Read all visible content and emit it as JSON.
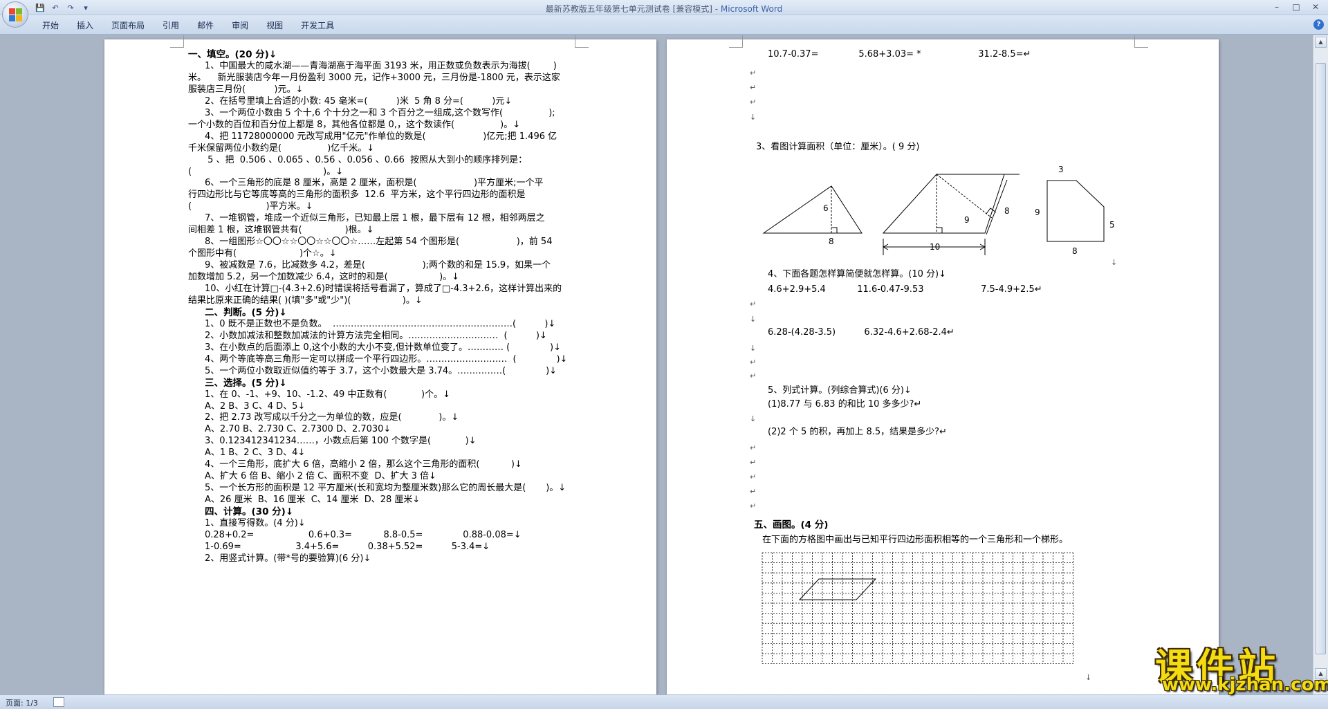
{
  "titlebar": {
    "doc_title": "最新苏教版五年级第七单元测试卷 [兼容模式] - ",
    "app_name": "Microsoft Word",
    "qat_save": "💾",
    "qat_undo": "↶",
    "qat_redo": "↷",
    "qat_more": "▾",
    "min": "–",
    "max": "□",
    "close": "✕"
  },
  "ribbon": {
    "tabs": [
      "开始",
      "插入",
      "页面布局",
      "引用",
      "邮件",
      "审阅",
      "视图",
      "开发工具"
    ],
    "help": "?"
  },
  "page1": {
    "lines": [
      "一、填空。(20 分)↓",
      "1、中国最大的咸水湖——青海湖高于海平面 3193 米，用正数或负数表示为海拔(        )",
      "米。    新光服装店今年一月份盈利 3000 元，记作+3000 元，三月份是-1800 元，表示这家",
      "服装店三月份(          )元。↓",
      "2、在括号里填上合适的小数: 45 毫米=(          )米  5 角 8 分=(          )元↓",
      "3、一个两位小数由 5 个十,6 个十分之一和 3 个百分之一组成,这个数写作(                );",
      "一个小数的百位和百分位上都是 8，其他各位都是 0,，这个数读作(                )。↓",
      "4、把 11728000000 元改写成用\"亿元\"作单位的数是(                    )亿元;把 1.496 亿",
      "千米保留两位小数约是(                )亿千米。↓",
      " 5 、把  0.506 、0.065 、0.56 、0.056 、0.66  按照从大到小的顺序排列是：",
      "(                                              )。↓",
      "6、一个三角形的底是 8 厘米，高是 2 厘米，面积是(                    )平方厘米;一个平",
      "行四边形比与它等底等高的三角形的面积多  12.6  平方米，这个平行四边形的面积是",
      "(                          )平方米。↓",
      "7、一堆钢管，堆成一个近似三角形，已知最上层 1 根，最下层有 12 根，相邻两层之",
      "间相差 1 根，这堆钢管共有(               )根。↓",
      "8、一组图形☆〇〇☆☆〇〇☆☆〇〇☆……左起第 54 个图形是(                    )，前 54",
      "个图形中有(                      )个☆。↓",
      "9、被减数是 7.6，比减数多 4.2，差是(                    );两个数的和是 15.9，如果一个",
      "加数增加 5.2，另一个加数减少 6.4，这时的和是(                  )。↓",
      "10、小红在计算□-(4.3+2.6)时错误将括号看漏了，算成了□-4.3+2.6，这样计算出来的",
      "结果比原来正确的结果( )(填\"多\"或\"少\")(                  )。↓",
      "二、判断。(5 分)↓",
      "1、0 既不是正数也不是负数。  ……………………………………………………(          )↓",
      "2、小数加减法和整数加减法的计算方法完全相同。…………………………  (          )↓",
      "3、在小数点的后面添上 0,这个小数的大小不变,但计数单位变了。………… (              )↓",
      "4、两个等底等高三角形一定可以拼成一个平行四边形。………………………  (              )↓",
      "5、一个两位小数取近似值约等于 3.7，这个小数最大是 3.74。……………(              )↓",
      "三、选择。(5 分)↓",
      "1、在 0、-1、+9、10、-1.2、49 中正数有(            )个。↓",
      "A、2 B、3 C、4 D、5↓",
      "2、把 2.73 改写成以千分之一为单位的数，应是(             )。↓",
      "A、2.70 B、2.730 C、2.7300 D、2.7030↓",
      "3、0.123412341234……，小数点后第 100 个数字是(            )↓",
      "A、1 B、2 C、3 D、4↓",
      "4、一个三角形，底扩大 6 倍，高缩小 2 倍，那么这个三角形的面积(           )↓",
      "A、扩大 6 倍 B、缩小 2 倍 C、面积不变  D、扩大 3 倍↓",
      "5、一个长方形的面积是 12 平方厘米(长和宽均为整厘米数)那么它的周长最大是(       )。↓",
      "A、26 厘米  B、16 厘米  C、14 厘米  D、28 厘米↓",
      "四、计算。(30 分)↓",
      "1、直接写得数。(4 分)↓",
      "0.28+0.2=                   0.6+0.3=           8.8-0.5=              0.88-0.08=↓",
      "1-0.69=                   3.4+5.6=          0.38+5.52=          5-3.4=↓",
      "2、用竖式计算。(带*号的要验算)(6 分)↓"
    ]
  },
  "page2": {
    "calc_line": "10.7-0.37=              5.68+3.03= *                    31.2-8.5=↵",
    "q3": "3、看图计算面积（单位：厘米）。( 9 分)",
    "fig1": {
      "h": "6",
      "b": "8"
    },
    "fig2": {
      "h": "9",
      "s": "8",
      "b": "10"
    },
    "fig3": {
      "top": "3",
      "left": "9",
      "right": "5",
      "bottom": "8"
    },
    "q4": "4、下面各题怎样算简便就怎样算。(10 分)↓",
    "q4_row1": "4.6+2.9+5.4           11.6-0.47-9.53                    7.5-4.9+2.5↵",
    "q4_row2": "6.28-(4.28-3.5)          6.32-4.6+2.68-2.4↵",
    "q5": "5、列式计算。(列综合算式)(6 分)↓",
    "q5_1": "(1)8.77 与 6.83 的和比 10 多多少?↵",
    "q5_2": "(2)2 个 5 的积，再加上 8.5，结果是多少?↵",
    "s5": "五、画图。(4 分)",
    "s5_text": "在下面的方格图中画出与已知平行四边形面积相等的一个三角形和一个梯形。",
    "para": "↵",
    "down": "↓"
  },
  "statusbar": {
    "page": "页面: 1/3"
  },
  "watermark": {
    "main": "课件站",
    "sub": "www.kjzhan.com"
  }
}
